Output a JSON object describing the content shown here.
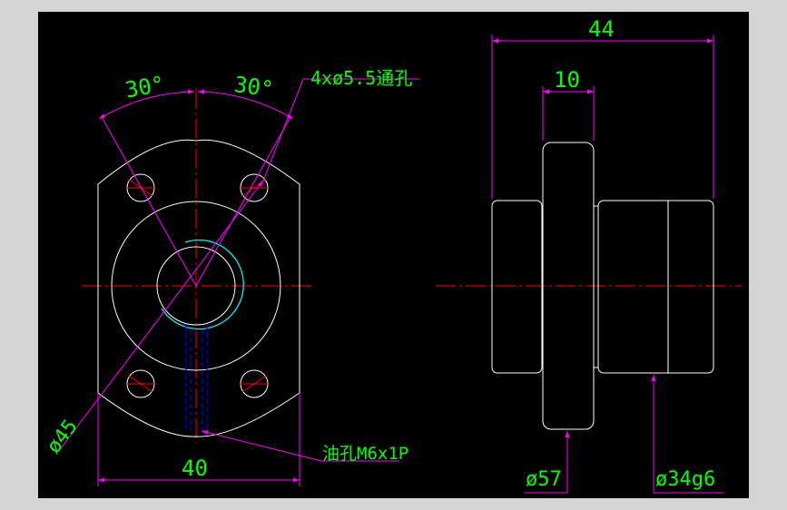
{
  "drawing": {
    "colors": {
      "background": "#000000",
      "viewport_border": "#d4d4d4",
      "outline": "#ffffff",
      "centerline": "#ff0000",
      "dimension": "#ff00ff",
      "text": "#00ff00",
      "hidden_line": "#0000ff",
      "thread_arc": "#00ffff"
    },
    "left_view": {
      "angle_left": "30°",
      "angle_right": "30°",
      "bolt_holes": "4xø5.5通孔",
      "diameter_pcd": "ø45",
      "width": "40",
      "oil_hole": "油孔M6x1P"
    },
    "right_view": {
      "overall_length": "44",
      "flange_thickness": "10",
      "flange_diameter": "ø57",
      "body_diameter": "ø34g6"
    }
  }
}
